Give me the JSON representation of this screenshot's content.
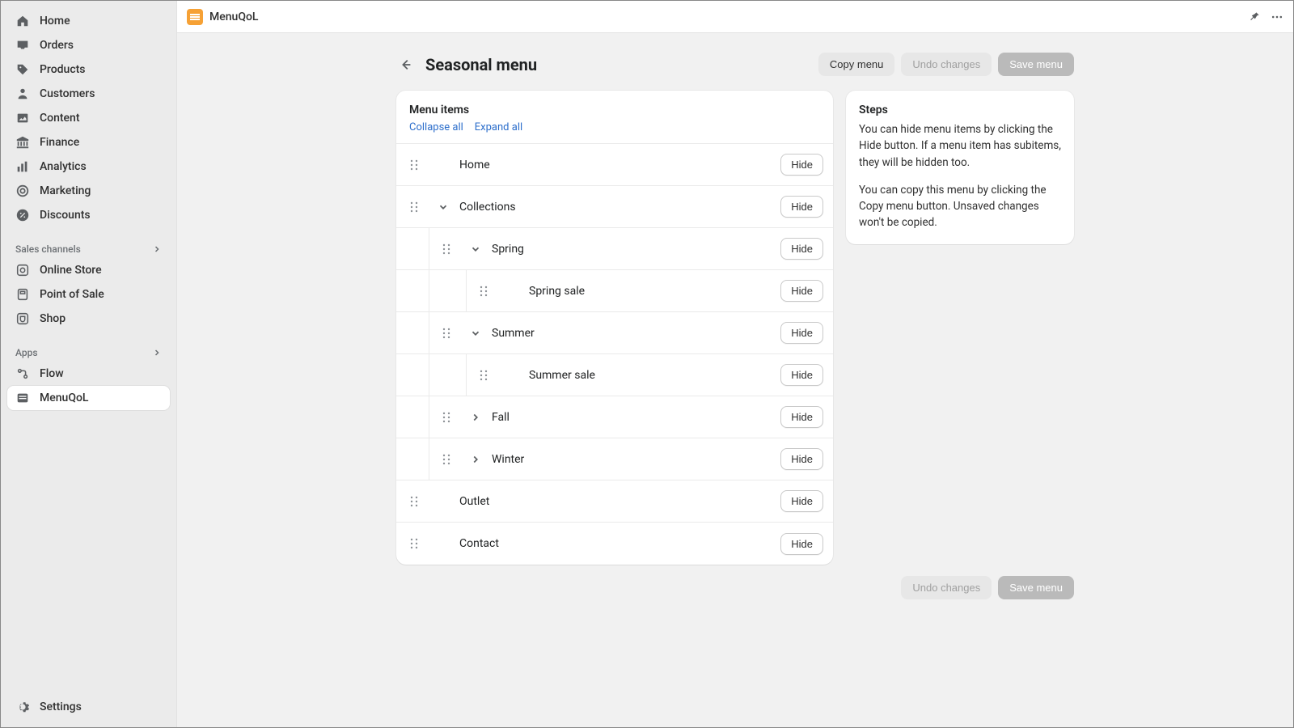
{
  "sidebar": {
    "primary": [
      {
        "label": "Home"
      },
      {
        "label": "Orders"
      },
      {
        "label": "Products"
      },
      {
        "label": "Customers"
      },
      {
        "label": "Content"
      },
      {
        "label": "Finance"
      },
      {
        "label": "Analytics"
      },
      {
        "label": "Marketing"
      },
      {
        "label": "Discounts"
      }
    ],
    "channels_heading": "Sales channels",
    "channels": [
      {
        "label": "Online Store"
      },
      {
        "label": "Point of Sale"
      },
      {
        "label": "Shop"
      }
    ],
    "apps_heading": "Apps",
    "apps": [
      {
        "label": "Flow"
      },
      {
        "label": "MenuQoL"
      }
    ],
    "settings_label": "Settings"
  },
  "topbar": {
    "app_name": "MenuQoL"
  },
  "page": {
    "title": "Seasonal menu",
    "copy_label": "Copy menu",
    "undo_label": "Undo changes",
    "save_label": "Save menu"
  },
  "menuitems": {
    "heading": "Menu items",
    "collapse_label": "Collapse all",
    "expand_label": "Expand all",
    "hide_label": "Hide",
    "rows": {
      "home": "Home",
      "collections": "Collections",
      "spring": "Spring",
      "spring_sale": "Spring sale",
      "summer": "Summer",
      "summer_sale": "Summer sale",
      "fall": "Fall",
      "winter": "Winter",
      "outlet": "Outlet",
      "contact": "Contact"
    }
  },
  "steps": {
    "heading": "Steps",
    "p1": "You can hide menu items by clicking the Hide button. If a menu item has subitems, they will be hidden too.",
    "p2": "You can copy this menu by clicking the Copy menu button. Unsaved changes won't be copied."
  }
}
